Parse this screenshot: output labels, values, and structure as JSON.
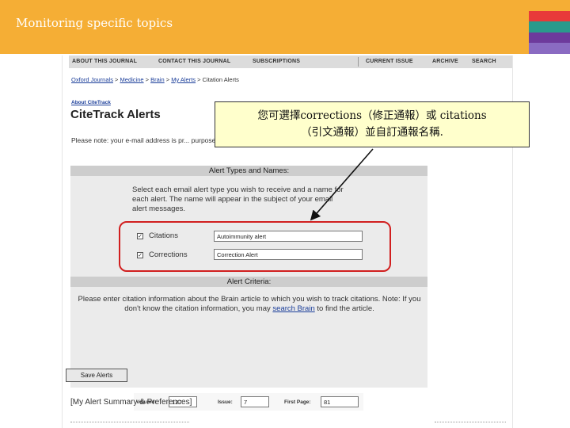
{
  "slide": {
    "title": "Monitoring specific topics",
    "strip_colors": [
      "#f5ae35",
      "#e83a3a",
      "#2a9a8c",
      "#6d3a9c",
      "#8a6bc2"
    ]
  },
  "nav": {
    "items": [
      "ABOUT THIS JOURNAL",
      "CONTACT THIS JOURNAL",
      "SUBSCRIPTIONS",
      "CURRENT ISSUE",
      "ARCHIVE",
      "SEARCH"
    ]
  },
  "breadcrumb": {
    "items": [
      "Oxford Journals",
      "Medicine",
      "Brain",
      "My Alerts",
      "Citation Alerts"
    ],
    "separator": ">"
  },
  "page": {
    "about_link": "About CiteTrack",
    "heading": "CiteTrack Alerts",
    "note": "Please note: your e-mail address is pr... purposes."
  },
  "types_panel": {
    "header": "Alert Types and Names:",
    "instructions": "Select each email alert type you wish to receive and a name for each alert. The name will appear in the subject of your email alert messages.",
    "rows": [
      {
        "checked": "✓",
        "label": "Citations",
        "value": "Autoimmunity alert"
      },
      {
        "checked": "✓",
        "label": "Corrections",
        "value": "Correction Alert"
      }
    ]
  },
  "criteria_panel": {
    "header": "Alert Criteria:",
    "text_before": "Please enter citation information about the Brain article to which you wish to track citations. Note: If you don't know the citation information, you may",
    "link": "search Brain",
    "text_after": "to find the article.",
    "fields": [
      {
        "label": "Volume:",
        "value": "127"
      },
      {
        "label": "Issue:",
        "value": "7"
      },
      {
        "label": "First Page:",
        "value": "81"
      }
    ]
  },
  "save_button": "Save Alerts",
  "summary_link": "[My Alert Summary & Preferences]",
  "callout": {
    "line1": "您可選擇corrections（修正通報）或 citations",
    "line2": "（引文通報）並自訂通報名稱."
  }
}
